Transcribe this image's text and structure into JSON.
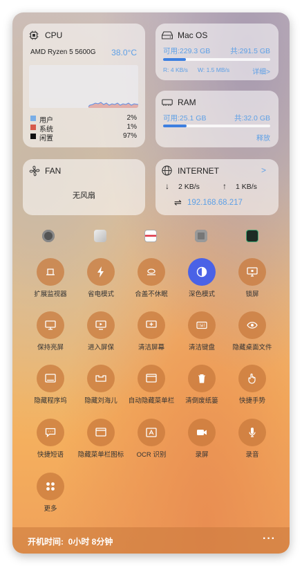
{
  "cpu": {
    "title": "CPU",
    "model": "AMD Ryzen 5 5600G",
    "temp": "38.0°C",
    "legend": [
      {
        "label": "用户",
        "value": "2%",
        "color": "#7aaee6"
      },
      {
        "label": "系统",
        "value": "1%",
        "color": "#d65a4a"
      },
      {
        "label": "闲置",
        "value": "97%",
        "color": "#111111"
      }
    ]
  },
  "disk": {
    "title": "Mac OS",
    "available": "可用:229.3 GB",
    "total": "共:291.5 GB",
    "read": "R: 4 KB/s",
    "write": "W: 1.5 MB/s",
    "detail": "详细>",
    "used_fraction": 0.21
  },
  "ram": {
    "title": "RAM",
    "available": "可用:25.1 GB",
    "total": "共:32.0 GB",
    "release": "释放",
    "used_fraction": 0.22
  },
  "fan": {
    "title": "FAN",
    "status": "无风扇"
  },
  "internet": {
    "title": "INTERNET",
    "more": ">",
    "down": "2 KB/s",
    "up": "1 KB/s",
    "ip": "192.168.68.217"
  },
  "dock_icons": [
    "settings-app-icon",
    "finder-app-icon",
    "preview-app-icon",
    "camera-app-icon",
    "activity-monitor-app-icon"
  ],
  "tools": [
    {
      "label": "扩展监视器"
    },
    {
      "label": "省电模式"
    },
    {
      "label": "合盖不休眠"
    },
    {
      "label": "深色模式"
    },
    {
      "label": "锁屏"
    },
    {
      "label": "保持亮屏"
    },
    {
      "label": "进入屏保"
    },
    {
      "label": "清洁屏幕"
    },
    {
      "label": "清洁键盘"
    },
    {
      "label": "隐藏桌面文件"
    },
    {
      "label": "隐藏程序坞"
    },
    {
      "label": "隐藏刘海儿"
    },
    {
      "label": "自动隐藏菜单栏"
    },
    {
      "label": "清倒废纸篓"
    },
    {
      "label": "快捷手势"
    },
    {
      "label": "快捷短语"
    },
    {
      "label": "隐藏菜单栏图标"
    },
    {
      "label": "OCR 识别"
    },
    {
      "label": "录屏"
    },
    {
      "label": "录音"
    },
    {
      "label": "更多"
    }
  ],
  "footer": {
    "uptime": "开机时间:  0小时 8分钟",
    "menu": "···"
  }
}
